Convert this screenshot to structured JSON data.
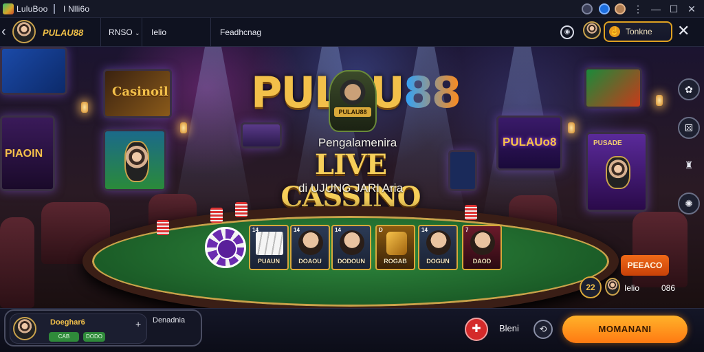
{
  "titlebar": {
    "app_name": "LuluBoo",
    "tab_label": "I Nlli6o"
  },
  "nav": {
    "brand": "PULAU88",
    "items": [
      {
        "label": "RNSO"
      },
      {
        "label": "Ielio"
      },
      {
        "label": "Feadhcnag"
      }
    ],
    "promo_label": "Tonkne"
  },
  "hero": {
    "logo_part1": "PULAU",
    "logo_part2": "88",
    "emblem_label": "PULAU88",
    "subtitle": "Pengalamenira",
    "headline": "LIVE CASSINO",
    "tagline": "di UJUNG JARI Aria"
  },
  "scene": {
    "wall_screen_label": "Casinoil",
    "left_screen_label": "PIAOIN",
    "right_neon_label": "PULAUo8",
    "right_machine_label": "PUSADE"
  },
  "cards": [
    {
      "index": "14",
      "label": "PUAUN"
    },
    {
      "index": "14",
      "label": "DOAOU"
    },
    {
      "index": "14",
      "label": "DODOUN"
    },
    {
      "index": "D",
      "label": "ROGAB"
    },
    {
      "index": "14",
      "label": "DOGUN"
    },
    {
      "index": "7",
      "label": "DAOD"
    }
  ],
  "side_panel": {
    "repeat_label": "PEEACO",
    "bet_label": "Ielio",
    "bet_value": "086"
  },
  "user": {
    "name": "Doeghar6",
    "badge1": "CAB",
    "badge2": "DODO",
    "label": "Denadnia",
    "plus": "+"
  },
  "bottom": {
    "mid_label": "Bleni",
    "cta_label": "MOMANANI"
  },
  "colors": {
    "accent": "#e0a221",
    "cta": "#ff8a1a",
    "felt": "#2f8a3e"
  }
}
